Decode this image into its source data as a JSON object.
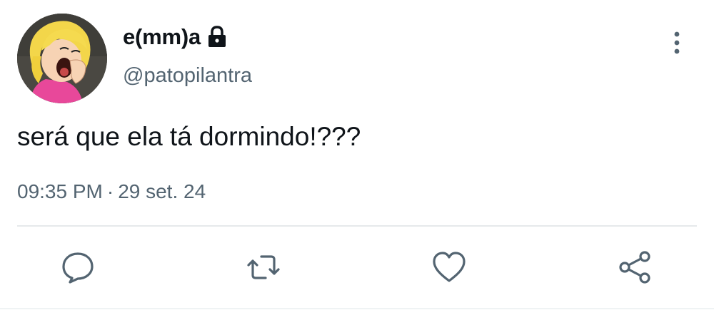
{
  "tweet": {
    "author": {
      "display_name": "e(mm)a",
      "handle": "@patopilantra",
      "protected": true,
      "avatar_icon": "cartoon-girl-avatar"
    },
    "text": "será que ela tá dormindo!???",
    "time": "09:35 PM",
    "separator": "·",
    "date": "29 set. 24"
  },
  "icons": {
    "more": "more-vertical-icon",
    "lock": "lock-icon",
    "reply": "reply-icon",
    "retweet": "retweet-icon",
    "like": "heart-icon",
    "share": "share-icon"
  },
  "colors": {
    "primary_text": "#0f1419",
    "secondary_text": "#536471",
    "icon": "#536471",
    "divider": "#e6e9eb"
  }
}
